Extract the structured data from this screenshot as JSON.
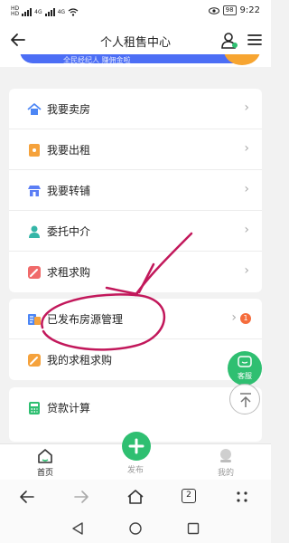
{
  "status_bar": {
    "sim_labels": [
      "HD",
      "HD"
    ],
    "network_labels": [
      "4G",
      "4G"
    ],
    "battery": "98",
    "time": "9:22"
  },
  "header": {
    "title": "个人租售中心"
  },
  "banner": {
    "text": "全民经纪人 赚佣金啦"
  },
  "menu_groups": [
    {
      "items": [
        {
          "label": "我要卖房",
          "icon": "house-icon",
          "color": "#4c86f5"
        },
        {
          "label": "我要出租",
          "icon": "rent-icon",
          "color": "#f5a23c"
        },
        {
          "label": "我要转铺",
          "icon": "shop-icon",
          "color": "#5b7ef5"
        },
        {
          "label": "委托中介",
          "icon": "agent-icon",
          "color": "#35b6a8"
        },
        {
          "label": "求租求购",
          "icon": "pencil-icon",
          "color": "#f06a6a"
        }
      ]
    },
    {
      "items": [
        {
          "label": "已发布房源管理",
          "icon": "listing-icon",
          "color": "#4c86f5",
          "badge": "1"
        },
        {
          "label": "我的求租求购",
          "icon": "pencil-icon",
          "color": "#f5a23c"
        }
      ]
    },
    {
      "items": [
        {
          "label": "贷款计算",
          "icon": "calculator-icon",
          "color": "#2fbf71"
        }
      ]
    }
  ],
  "floating": {
    "service_label": "客服"
  },
  "tab_bar": {
    "home": "首页",
    "publish": "发布",
    "mine": "我的"
  },
  "browser": {
    "tab_count": "2"
  },
  "colors": {
    "accent_green": "#2fbf71",
    "badge_orange": "#f56c3c",
    "scribble": "#c2185b"
  }
}
